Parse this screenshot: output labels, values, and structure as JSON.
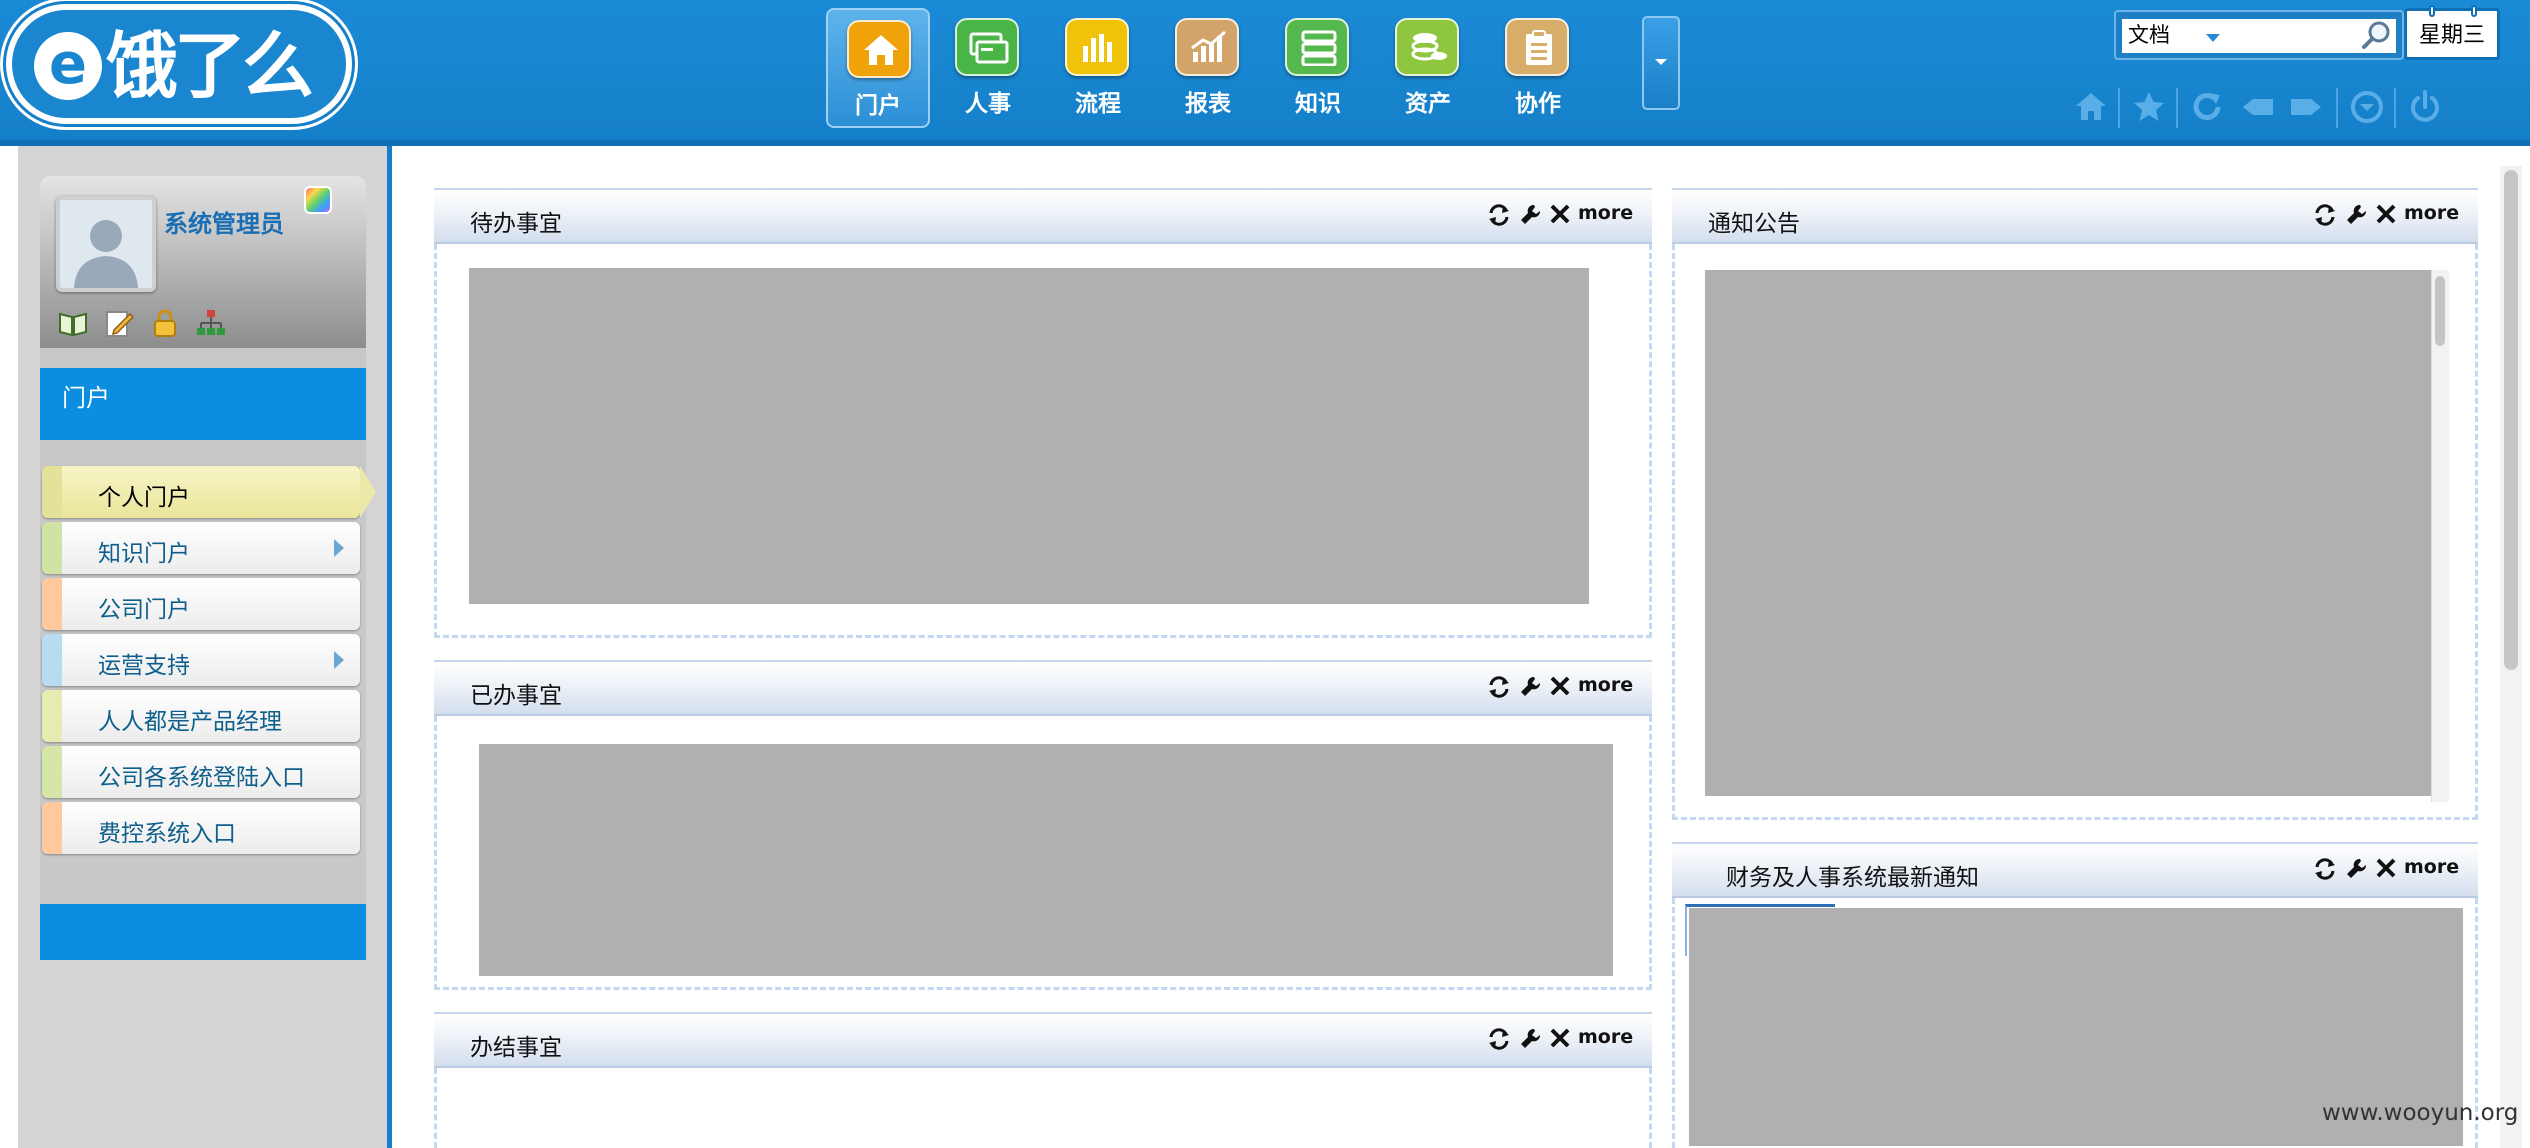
{
  "header": {
    "logo_text": "饿了么",
    "nav": [
      {
        "label": "门户",
        "icon": "home-icon",
        "color": "#f0a20a",
        "active": true
      },
      {
        "label": "人事",
        "icon": "hr-cards-icon",
        "color": "#49b546"
      },
      {
        "label": "流程",
        "icon": "bar-chart-icon",
        "color": "#f1c20a"
      },
      {
        "label": "报表",
        "icon": "report-chart-icon",
        "color": "#d2a46a"
      },
      {
        "label": "知识",
        "icon": "knowledge-stack-icon",
        "color": "#55b84e"
      },
      {
        "label": "资产",
        "icon": "coins-icon",
        "color": "#8ec63f"
      },
      {
        "label": "协作",
        "icon": "clipboard-icon",
        "color": "#d8ad6a"
      }
    ],
    "search_type": "文档",
    "weekday": "星期三"
  },
  "sidebar": {
    "user_name": "系统管理员",
    "section_label": "门户",
    "menu": [
      {
        "label": "个人门户",
        "strip": "#e4e29a",
        "active": true
      },
      {
        "label": "知识门户",
        "strip": "#cfe3a2",
        "arrow": true
      },
      {
        "label": "公司门户",
        "strip": "#ffc9a0"
      },
      {
        "label": "运营支持",
        "strip": "#b7dcef",
        "arrow": true
      },
      {
        "label": "人人都是产品经理",
        "strip": "#e6ebb0"
      },
      {
        "label": "公司各系统登陆入口",
        "strip": "#d5e6a6"
      },
      {
        "label": "费控系统入口",
        "strip": "#ffc9a0"
      }
    ]
  },
  "portlets": {
    "todo": {
      "title": "待办事宜",
      "more": "more"
    },
    "done": {
      "title": "已办事宜",
      "more": "more"
    },
    "finished": {
      "title": "办结事宜",
      "more": "more"
    },
    "notice": {
      "title": "通知公告",
      "more": "more"
    },
    "finance": {
      "title": "财务及人事系统最新通知",
      "more": "more"
    }
  },
  "watermark": "www.wooyun.org",
  "colors": {
    "brand_blue": "#1580c9",
    "menu_text": "#0e5f8c",
    "portlet_border": "#c4d8f4"
  }
}
